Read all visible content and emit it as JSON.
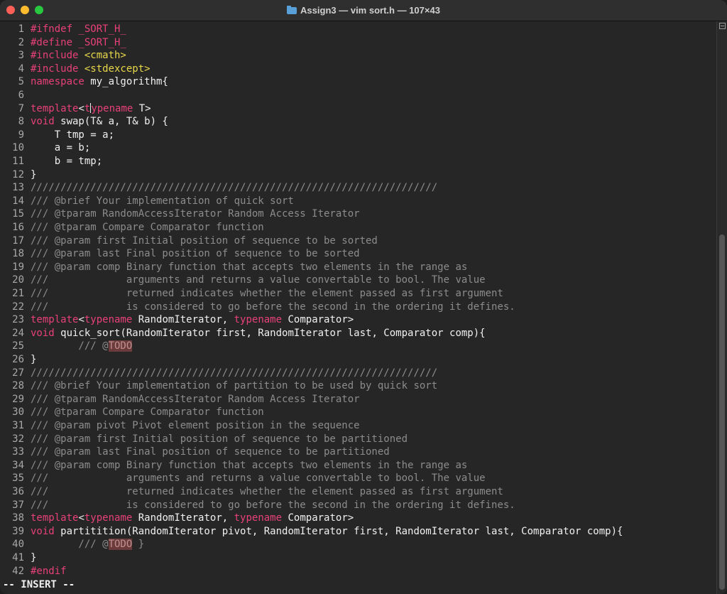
{
  "window": {
    "title": "Assign3 — vim sort.h — 107×43"
  },
  "lines": [
    {
      "n": "1",
      "parts": [
        {
          "t": "#ifndef _SORT_H_",
          "c": "kw"
        }
      ]
    },
    {
      "n": "2",
      "parts": [
        {
          "t": "#define _SORT_H_",
          "c": "kw"
        }
      ]
    },
    {
      "n": "3",
      "parts": [
        {
          "t": "#include ",
          "c": "kw"
        },
        {
          "t": "<cmath>",
          "c": "str"
        }
      ]
    },
    {
      "n": "4",
      "parts": [
        {
          "t": "#include ",
          "c": "kw"
        },
        {
          "t": "<stdexcept>",
          "c": "str"
        }
      ]
    },
    {
      "n": "5",
      "parts": [
        {
          "t": "namespace",
          "c": "kw"
        },
        {
          "t": " my_algorithm{",
          "c": ""
        }
      ]
    },
    {
      "n": "6",
      "parts": []
    },
    {
      "n": "7",
      "parts": [
        {
          "t": "template",
          "c": "kw"
        },
        {
          "t": "<",
          "c": ""
        },
        {
          "t": "t",
          "c": "kw"
        },
        {
          "t": "",
          "c": "cursor"
        },
        {
          "t": "ypename",
          "c": "kw"
        },
        {
          "t": " T>",
          "c": ""
        }
      ]
    },
    {
      "n": "8",
      "parts": [
        {
          "t": "void",
          "c": "kw"
        },
        {
          "t": " swap(T& a, T& b) {",
          "c": ""
        }
      ]
    },
    {
      "n": "9",
      "parts": [
        {
          "t": "    T tmp = a;",
          "c": ""
        }
      ]
    },
    {
      "n": "10",
      "parts": [
        {
          "t": "    a = b;",
          "c": ""
        }
      ]
    },
    {
      "n": "11",
      "parts": [
        {
          "t": "    b = tmp;",
          "c": ""
        }
      ]
    },
    {
      "n": "12",
      "parts": [
        {
          "t": "}",
          "c": ""
        }
      ]
    },
    {
      "n": "13",
      "parts": [
        {
          "t": "////////////////////////////////////////////////////////////////////",
          "c": "cm"
        }
      ]
    },
    {
      "n": "14",
      "parts": [
        {
          "t": "/// @brief Your implementation of quick sort",
          "c": "cm"
        }
      ]
    },
    {
      "n": "15",
      "parts": [
        {
          "t": "/// @tparam RandomAccessIterator Random Access Iterator",
          "c": "cm"
        }
      ]
    },
    {
      "n": "16",
      "parts": [
        {
          "t": "/// @tparam Compare Comparator function",
          "c": "cm"
        }
      ]
    },
    {
      "n": "17",
      "parts": [
        {
          "t": "/// @param first Initial position of sequence to be sorted",
          "c": "cm"
        }
      ]
    },
    {
      "n": "18",
      "parts": [
        {
          "t": "/// @param last Final position of sequence to be sorted",
          "c": "cm"
        }
      ]
    },
    {
      "n": "19",
      "parts": [
        {
          "t": "/// @param comp Binary function that accepts two elements in the range as",
          "c": "cm"
        }
      ]
    },
    {
      "n": "20",
      "parts": [
        {
          "t": "///             arguments and returns a value convertable to bool. The value",
          "c": "cm"
        }
      ]
    },
    {
      "n": "21",
      "parts": [
        {
          "t": "///             returned indicates whether the element passed as first argument",
          "c": "cm"
        }
      ]
    },
    {
      "n": "22",
      "parts": [
        {
          "t": "///             is considered to go before the second in the ordering it defines.",
          "c": "cm"
        }
      ]
    },
    {
      "n": "23",
      "parts": [
        {
          "t": "template",
          "c": "kw"
        },
        {
          "t": "<",
          "c": ""
        },
        {
          "t": "typename",
          "c": "kw"
        },
        {
          "t": " RandomIterator, ",
          "c": ""
        },
        {
          "t": "typename",
          "c": "kw"
        },
        {
          "t": " Comparator>",
          "c": ""
        }
      ]
    },
    {
      "n": "24",
      "parts": [
        {
          "t": "void",
          "c": "kw"
        },
        {
          "t": " quick_sort(RandomIterator first, RandomIterator last, Comparator comp){",
          "c": ""
        }
      ]
    },
    {
      "n": "25",
      "parts": [
        {
          "t": "        /// @",
          "c": "cm"
        },
        {
          "t": "TODO",
          "c": "todo"
        }
      ]
    },
    {
      "n": "26",
      "parts": [
        {
          "t": "}",
          "c": ""
        }
      ]
    },
    {
      "n": "27",
      "parts": [
        {
          "t": "////////////////////////////////////////////////////////////////////",
          "c": "cm"
        }
      ]
    },
    {
      "n": "28",
      "parts": [
        {
          "t": "/// @brief Your implementation of partition to be used by quick sort",
          "c": "cm"
        }
      ]
    },
    {
      "n": "29",
      "parts": [
        {
          "t": "/// @tparam RandomAccessIterator Random Access Iterator",
          "c": "cm"
        }
      ]
    },
    {
      "n": "30",
      "parts": [
        {
          "t": "/// @tparam Compare Comparator function",
          "c": "cm"
        }
      ]
    },
    {
      "n": "31",
      "parts": [
        {
          "t": "/// @param pivot Pivot element position in the sequence",
          "c": "cm"
        }
      ]
    },
    {
      "n": "32",
      "parts": [
        {
          "t": "/// @param first Initial position of sequence to be partitioned",
          "c": "cm"
        }
      ]
    },
    {
      "n": "33",
      "parts": [
        {
          "t": "/// @param last Final position of sequence to be partitioned",
          "c": "cm"
        }
      ]
    },
    {
      "n": "34",
      "parts": [
        {
          "t": "/// @param comp Binary function that accepts two elements in the range as",
          "c": "cm"
        }
      ]
    },
    {
      "n": "35",
      "parts": [
        {
          "t": "///             arguments and returns a value convertable to bool. The value",
          "c": "cm"
        }
      ]
    },
    {
      "n": "36",
      "parts": [
        {
          "t": "///             returned indicates whether the element passed as first argument",
          "c": "cm"
        }
      ]
    },
    {
      "n": "37",
      "parts": [
        {
          "t": "///             is considered to go before the second in the ordering it defines.",
          "c": "cm"
        }
      ]
    },
    {
      "n": "38",
      "parts": [
        {
          "t": "template",
          "c": "kw"
        },
        {
          "t": "<",
          "c": ""
        },
        {
          "t": "typename",
          "c": "kw"
        },
        {
          "t": " RandomIterator, ",
          "c": ""
        },
        {
          "t": "typename",
          "c": "kw"
        },
        {
          "t": " Comparator>",
          "c": ""
        }
      ]
    },
    {
      "n": "39",
      "parts": [
        {
          "t": "void",
          "c": "kw"
        },
        {
          "t": " partitition(RandomIterator pivot, RandomIterator first, RandomIterator last, Comparator comp){",
          "c": ""
        }
      ]
    },
    {
      "n": "40",
      "parts": [
        {
          "t": "        /// @",
          "c": "cm"
        },
        {
          "t": "TODO",
          "c": "todo"
        },
        {
          "t": " }",
          "c": "cm"
        }
      ]
    },
    {
      "n": "41",
      "parts": [
        {
          "t": "}",
          "c": ""
        }
      ]
    },
    {
      "n": "42",
      "parts": [
        {
          "t": "#endif",
          "c": "kw"
        }
      ]
    }
  ],
  "statusline": {
    "mode": "-- INSERT --"
  },
  "colors": {
    "keyword": "#e8407a",
    "string": "#e8d84a",
    "comment": "#8c8c8c",
    "text": "#f0f0f0",
    "todo_bg": "#6b3a3a"
  }
}
